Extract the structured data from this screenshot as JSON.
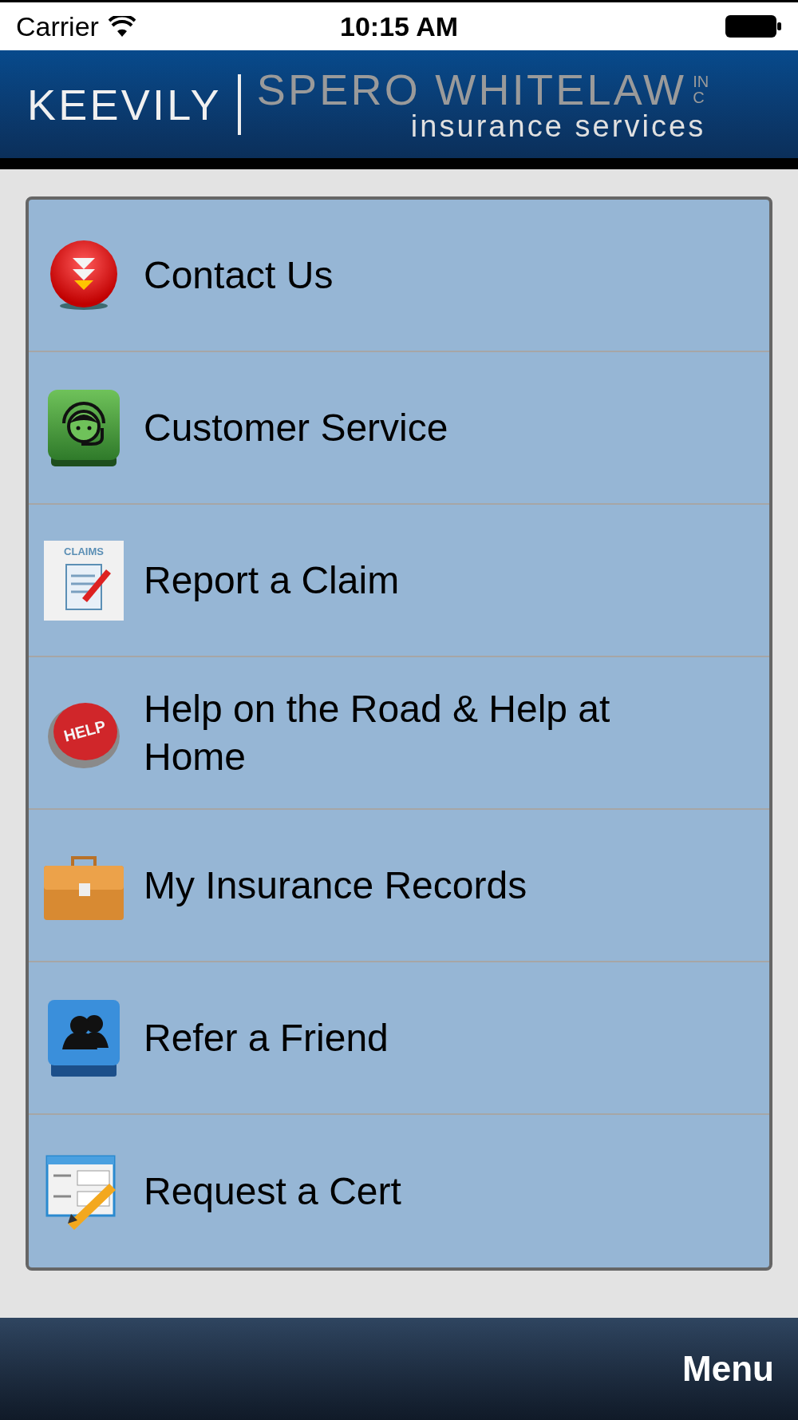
{
  "status_bar": {
    "carrier": "Carrier",
    "time": "10:15 AM"
  },
  "logo": {
    "primary": "KEEVILY",
    "secondary": "SPERO WHITELAW",
    "suffix": "INC",
    "tagline": "insurance services"
  },
  "menu_items": [
    {
      "label": "Contact Us",
      "kind": "arrows"
    },
    {
      "label": "Customer Service",
      "kind": "headset"
    },
    {
      "label": "Report a Claim",
      "kind": "claims",
      "icon_text": "CLAIMS"
    },
    {
      "label": "Help on the Road & Help at Home",
      "kind": "help",
      "icon_text": "HELP"
    },
    {
      "label": "My Insurance Records",
      "kind": "briefcase"
    },
    {
      "label": "Refer a Friend",
      "kind": "people"
    },
    {
      "label": "Request a Cert",
      "kind": "form"
    }
  ],
  "bottom_bar": {
    "menu_button": "Menu"
  }
}
